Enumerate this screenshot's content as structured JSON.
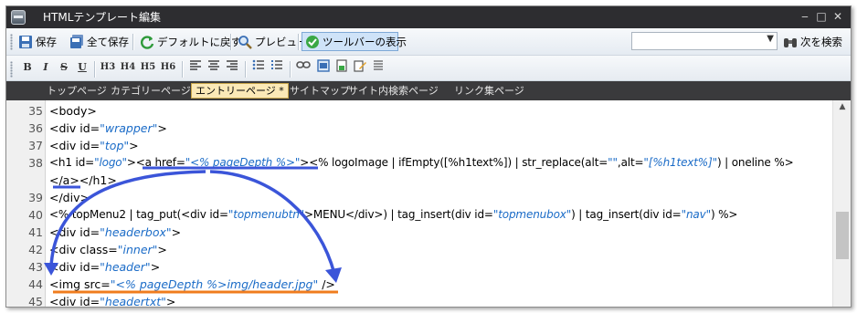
{
  "window": {
    "title": "HTMLテンプレート編集",
    "controls": [
      "‒",
      "□",
      "✕"
    ]
  },
  "toolbar": {
    "save": "保存",
    "save_all": "全て保存",
    "revert_default": "デフォルトに戻す",
    "preview": "プレビュー",
    "show_tools": "ツールバーの表示",
    "search_value": "",
    "search_next": "次を検索"
  },
  "format_toolbar": [
    "B",
    "I",
    "S",
    "U",
    "H3",
    "H4",
    "H5",
    "H6"
  ],
  "tabs": [
    {
      "label": "トップページ",
      "active": false
    },
    {
      "label": "カテゴリーページ",
      "active": false
    },
    {
      "label": "エントリーページ *",
      "active": true
    },
    {
      "label": "サイトマップ",
      "active": false
    },
    {
      "label": "サイト内検索ページ",
      "active": false
    },
    {
      "label": "リンク集ページ",
      "active": false
    }
  ],
  "code_lines": [
    {
      "num": "35",
      "text": "<body>"
    },
    {
      "num": "36",
      "text": "<div id=\"wrapper\">"
    },
    {
      "num": "37",
      "text": "<div id=\"top\">"
    },
    {
      "num": "38",
      "text": "<h1 id=\"logo\"><a href=\"<% pageDepth %>\"><% logoImage | ifEmpty([%h1text%]) | str_replace(alt=\"\",alt=\"[%h1text%]\") | oneline %>"
    },
    {
      "num": "",
      "text": "</a></h1>"
    },
    {
      "num": "39",
      "text": "</div>"
    },
    {
      "num": "40",
      "text": "<% topMenu2 | tag_put(<div id=\"topmenubtn\">MENU</div>) | tag_insert(div id=\"topmenubox\") | tag_insert(div id=\"nav\") %>"
    },
    {
      "num": "41",
      "text": "<div id=\"headerbox\">"
    },
    {
      "num": "42",
      "text": "<div class=\"inner\">"
    },
    {
      "num": "43",
      "text": "<div id=\"header\">"
    },
    {
      "num": "44",
      "text": "<img src=\"<% pageDepth %>img/header.jpg\" />"
    },
    {
      "num": "45",
      "text": "<div id=\"headertxt\">"
    }
  ],
  "colors": {
    "titlebar": "#2d2d30",
    "tabbar": "#3a3a3c",
    "attr_value": "#1a6bc7",
    "annotation_blue": "#3b55d9",
    "annotation_orange": "#f07c1e",
    "active_tab": "#fbe9b7"
  }
}
